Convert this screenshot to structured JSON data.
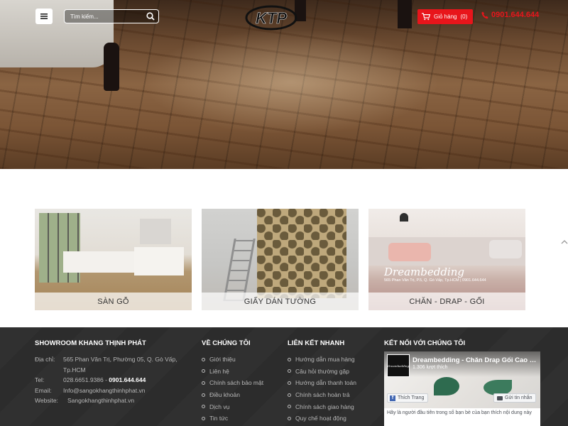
{
  "header": {
    "search_placeholder": "Tìm kiếm...",
    "logo_text": "KTP",
    "cart_label": "Giỏ hàng",
    "cart_count": "(0)",
    "phone": "0901.644.644"
  },
  "categories": [
    {
      "label": "SÀN GỖ"
    },
    {
      "label": "GIẤY DÁN TƯỜNG"
    },
    {
      "label": "CHĂN - DRAP - GỐI",
      "overlay_brand": "Dreambedding",
      "overlay_address": "565 Phan Văn Trị, P.5, Q. Gò Vấp, Tp.HCM | 0901.644.644"
    }
  ],
  "footer": {
    "showroom": {
      "title": "SHOWROOM KHANG THỊNH PHÁT",
      "address_label": "Địa chỉ:",
      "address": "565 Phan Văn Trị, Phường 05, Q. Gò Vấp, Tp.HCM",
      "tel_label": "Tel:",
      "tel": "028.6651.9386",
      "tel_sep": " - ",
      "mobile": "0901.644.644",
      "email_label": "Email:",
      "email": "Info@sangokhangthinhphat.vn",
      "website_label": "Website:",
      "website": "Sangokhangthinhphat.vn"
    },
    "about": {
      "title": "VỀ CHÚNG TÔI",
      "items": [
        "Giới thiệu",
        "Liên hệ",
        "Chính sách bảo mật",
        "Điều khoản",
        "Dịch vụ",
        "Tin tức"
      ]
    },
    "links": {
      "title": "LIÊN KẾT NHANH",
      "items": [
        "Hướng dẫn mua hàng",
        "Câu hỏi thường gặp",
        "Hướng dẫn thanh toán",
        "Chính sách hoàn trả",
        "Chính sách giao hàng",
        "Quy chế hoạt động"
      ]
    },
    "connect": {
      "title": "KẾT NỐI VỚI CHÚNG TÔI",
      "page_name": "Dreambedding - Chăn Drap Gối Cao Cấp",
      "likes": "1.306 lượt thích",
      "avatar_text": "Dreambedding",
      "like_button": "Thích Trang",
      "message_button": "Gửi tin nhắn",
      "note": "Hãy là người đầu tiên trong số bạn bè của bạn thích nội dung này"
    }
  },
  "colors": {
    "accent_red": "#e8151b",
    "footer_bg": "#2c2c2c"
  }
}
